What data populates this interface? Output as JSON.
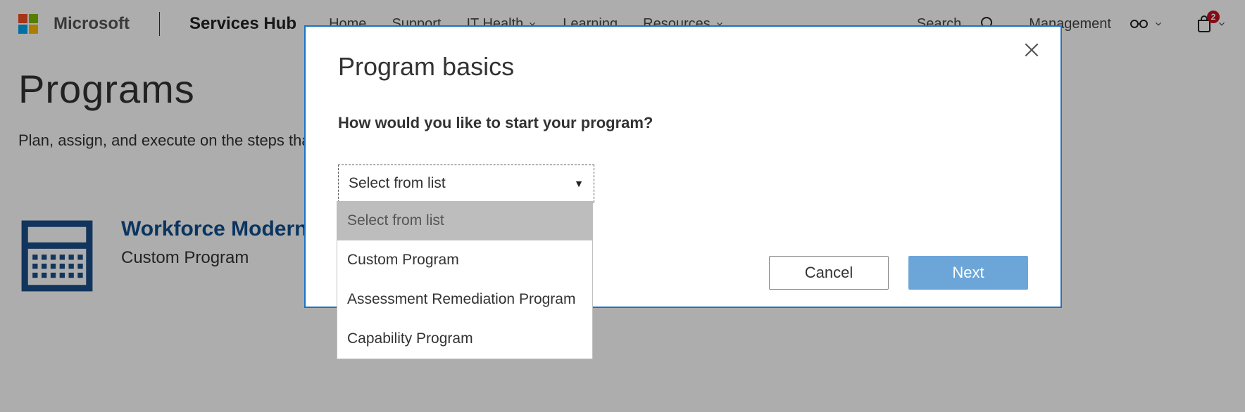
{
  "header": {
    "ms_name": "Microsoft",
    "hub_name": "Services Hub",
    "nav": [
      "Home",
      "Support",
      "IT Health",
      "Learning",
      "Resources"
    ],
    "search_label": "Search",
    "management_label": "Management",
    "badge_count": "2"
  },
  "page": {
    "title": "Programs",
    "subtitle": "Plan, assign, and execute on the steps that will help you reach your goals.",
    "card": {
      "title": "Workforce Modernization with Microsoft Teams",
      "subtitle": "Custom Program"
    }
  },
  "modal": {
    "title": "Program basics",
    "question": "How would you like to start your program?",
    "select_placeholder": "Select from list",
    "options": [
      "Select from list",
      "Custom Program",
      "Assessment Remediation Program",
      "Capability Program"
    ],
    "cancel": "Cancel",
    "next": "Next"
  }
}
